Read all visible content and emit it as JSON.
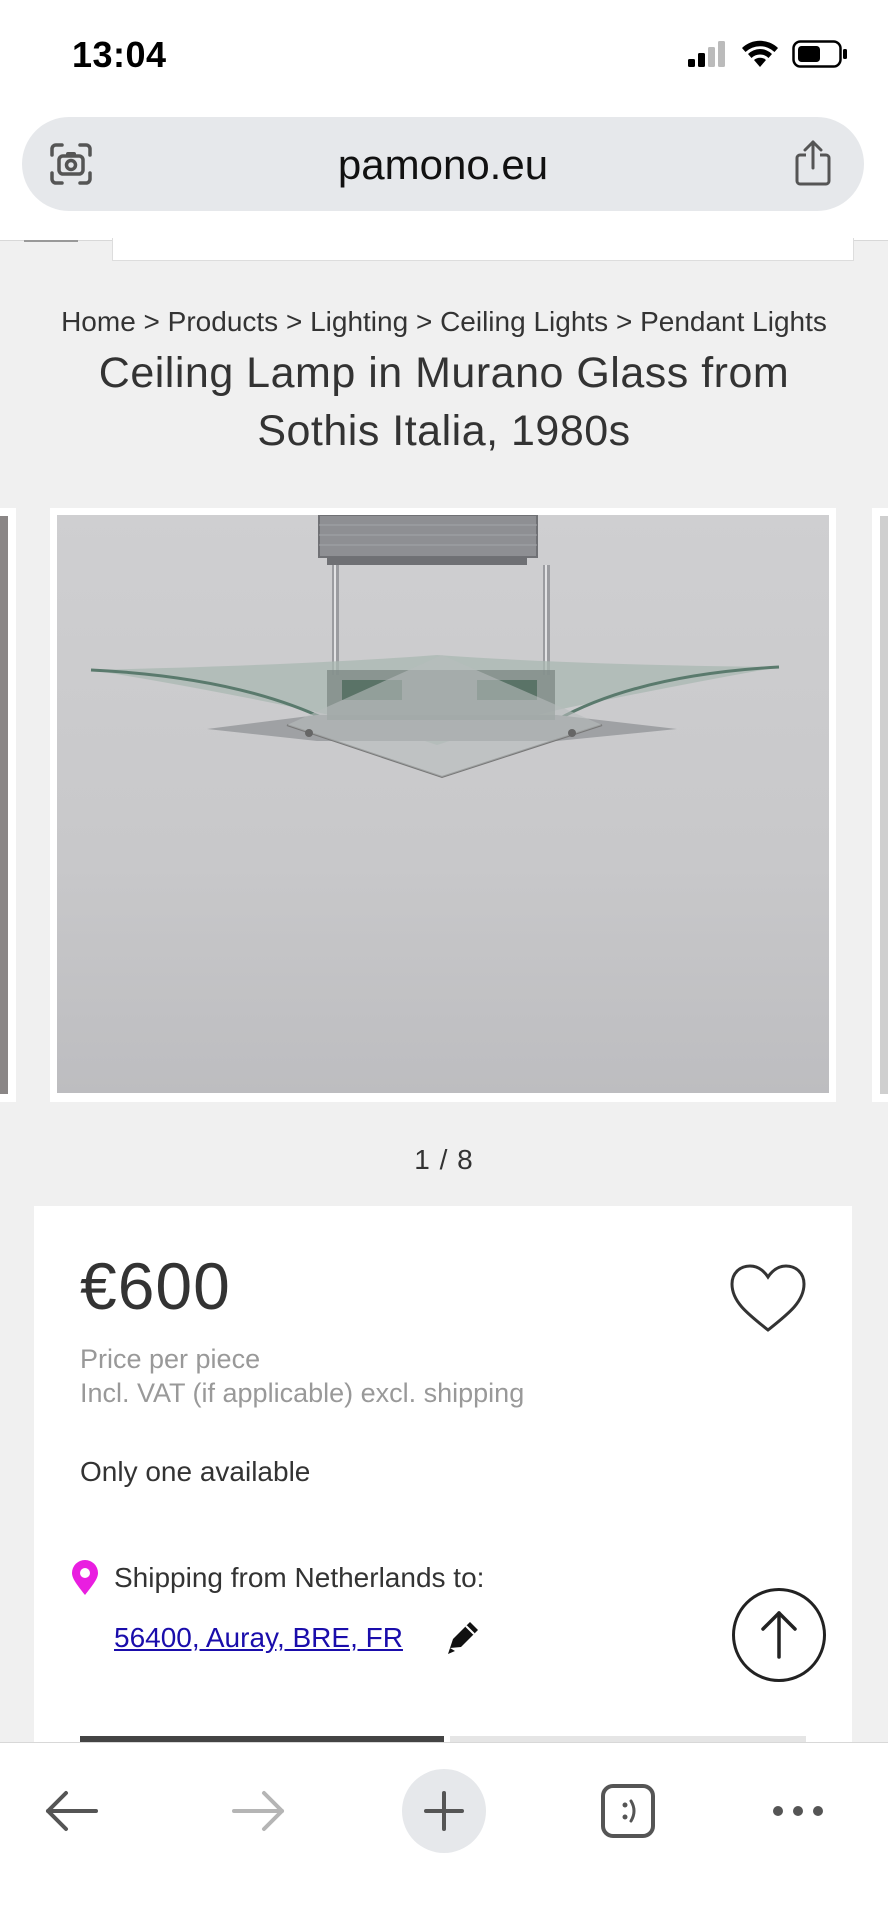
{
  "status_bar": {
    "time": "13:04"
  },
  "browser": {
    "url": "pamono.eu"
  },
  "breadcrumb": "Home > Products > Lighting > Ceiling Lights > Pendant Lights",
  "product": {
    "title": "Ceiling Lamp in Murano Glass from Sothis Italia, 1980s",
    "image_counter": "1 / 8",
    "image_current": 1,
    "image_total": 8,
    "price": "€600",
    "price_per": "Price per piece",
    "vat_note": "Incl. VAT (if applicable) excl. shipping",
    "availability": "Only one available",
    "shipping_label": "Shipping from Netherlands to:",
    "shipping_destination": "56400, Auray, BRE, FR"
  },
  "icons": {
    "visual_search": "camera-scan-icon",
    "share": "share-icon",
    "favorite": "heart-icon",
    "location": "location-pin-icon",
    "edit": "pencil-icon",
    "scroll_top": "arrow-up-icon",
    "back": "back-arrow-icon",
    "forward": "forward-arrow-icon",
    "new_tab": "plus-icon",
    "tabs": "tabs-icon",
    "menu": "more-icon"
  },
  "colors": {
    "pin": "#e91ee0",
    "link": "#1a0dab",
    "url_bar_bg": "#e6e8eb"
  }
}
